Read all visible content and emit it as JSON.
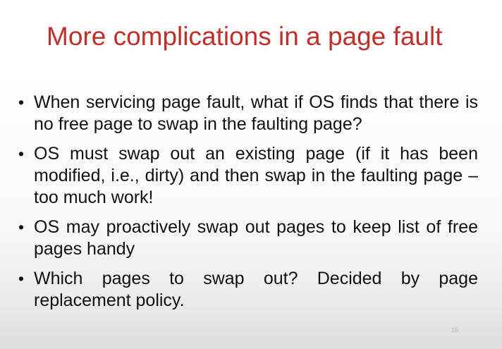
{
  "slide": {
    "title": "More complications in a page fault",
    "bullets": [
      "When servicing page fault, what if OS finds that there is no free page to swap in the faulting page?",
      "OS must swap out an existing page (if it has been  modified, i.e., dirty) and then swap in the faulting  page – too much work!",
      "OS may proactively swap out pages to keep list of  free pages handy",
      "Which pages to swap out? Decided by page  replacement policy."
    ],
    "bullet_symbol": "•",
    "page_number": "15"
  }
}
